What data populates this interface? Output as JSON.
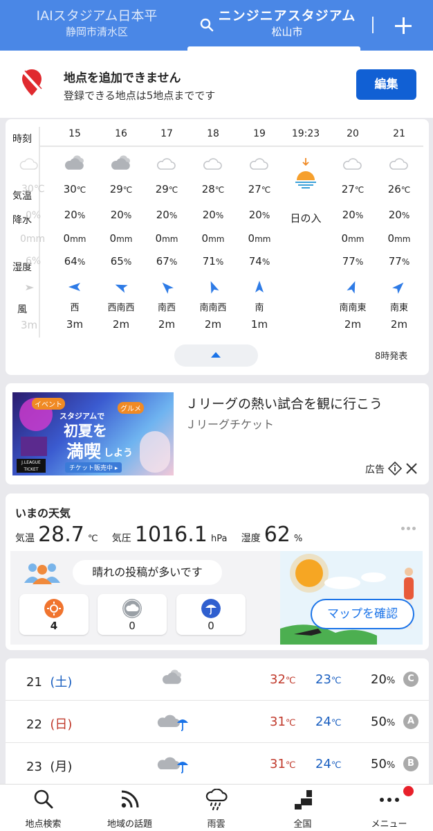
{
  "header": {
    "location_inactive": {
      "name": "IAIスタジアム日本平",
      "area": "静岡市清水区"
    },
    "location_active": {
      "name": "ニンジニアスタジアム",
      "area": "松山市"
    }
  },
  "notice": {
    "title": "地点を追加できません",
    "subtitle": "登録できる地点は5地点までです",
    "edit_label": "編集"
  },
  "hourly": {
    "row_labels": {
      "time": "時刻",
      "temp": "気温",
      "precip": "降水",
      "humidity": "湿度",
      "wind": "風"
    },
    "ghost_column": [
      "30℃",
      "0%",
      "0mm",
      "6%",
      "3m"
    ],
    "columns": [
      {
        "hour": "15",
        "icon": "cloudy-icon",
        "temp": "30",
        "temp_unit": "℃",
        "pop": "20",
        "pop_unit": "%",
        "rain": "0",
        "rain_unit": "mm",
        "hum": "64",
        "hum_unit": "%",
        "wind_dir": "西",
        "wind_speed": "3m",
        "wind_angle": 90
      },
      {
        "hour": "16",
        "icon": "cloudy-icon",
        "temp": "29",
        "temp_unit": "℃",
        "pop": "20",
        "pop_unit": "%",
        "rain": "0",
        "rain_unit": "mm",
        "hum": "65",
        "hum_unit": "%",
        "wind_dir": "西南西",
        "wind_speed": "2m",
        "wind_angle": 68
      },
      {
        "hour": "17",
        "icon": "cloud-outline-icon",
        "temp": "29",
        "temp_unit": "℃",
        "pop": "20",
        "pop_unit": "%",
        "rain": "0",
        "rain_unit": "mm",
        "hum": "67",
        "hum_unit": "%",
        "wind_dir": "南西",
        "wind_speed": "2m",
        "wind_angle": 45
      },
      {
        "hour": "18",
        "icon": "cloud-outline-icon",
        "temp": "28",
        "temp_unit": "℃",
        "pop": "20",
        "pop_unit": "%",
        "rain": "0",
        "rain_unit": "mm",
        "hum": "71",
        "hum_unit": "%",
        "wind_dir": "南南西",
        "wind_speed": "2m",
        "wind_angle": 22
      },
      {
        "hour": "19",
        "icon": "cloud-outline-icon",
        "temp": "27",
        "temp_unit": "℃",
        "pop": "20",
        "pop_unit": "%",
        "rain": "0",
        "rain_unit": "mm",
        "hum": "74",
        "hum_unit": "%",
        "wind_dir": "南",
        "wind_speed": "1m",
        "wind_angle": 0
      },
      {
        "hour": "19:23",
        "icon": "sunset-icon",
        "event": "日の入"
      },
      {
        "hour": "20",
        "icon": "cloud-outline-icon",
        "temp": "27",
        "temp_unit": "℃",
        "pop": "20",
        "pop_unit": "%",
        "rain": "0",
        "rain_unit": "mm",
        "hum": "77",
        "hum_unit": "%",
        "wind_dir": "南南東",
        "wind_speed": "2m",
        "wind_angle": -22
      },
      {
        "hour": "21",
        "icon": "cloud-outline-icon",
        "temp": "26",
        "temp_unit": "℃",
        "pop": "20",
        "pop_unit": "%",
        "rain": "0",
        "rain_unit": "mm",
        "hum": "77",
        "hum_unit": "%",
        "wind_dir": "南東",
        "wind_speed": "2m",
        "wind_angle": -45
      }
    ],
    "published": "8時発表"
  },
  "ad": {
    "title": "Ｊリーグの熱い試合を観に行こう",
    "sponsor": "Ｊリーグチケット",
    "label": "広告",
    "image_text": {
      "l1": "イベント",
      "l2": "グルメ",
      "l3": "スタジアムで",
      "l4": "初夏を",
      "l5": "満喫",
      "l6": "しよう",
      "l7": "チケット販売中 ▸",
      "l8": "J.LEAGUE TICKET"
    }
  },
  "now": {
    "title": "いまの天気",
    "temp_label": "気温",
    "temp_value": "28.7",
    "temp_unit": "℃",
    "pressure_label": "気圧",
    "pressure_value": "1016.1",
    "pressure_unit": "hPa",
    "humidity_label": "湿度",
    "humidity_value": "62",
    "humidity_unit": "%",
    "post_message": "晴れの投稿が多いです",
    "posts": [
      {
        "icon": "sunny-post-icon",
        "count": "4"
      },
      {
        "icon": "cloudy-post-icon",
        "count": "0"
      },
      {
        "icon": "rainy-post-icon",
        "count": "0"
      }
    ],
    "map_button": "マップを確認"
  },
  "forecast": [
    {
      "day": "21",
      "weekday": "(土)",
      "weekday_color": "#1a5fc0",
      "icon": "cloudy-icon",
      "high": "32",
      "low": "23",
      "unit": "℃",
      "pop": "20",
      "pop_unit": "%",
      "grade": "C"
    },
    {
      "day": "22",
      "weekday": "(日)",
      "weekday_color": "#c0392b",
      "icon": "cloud-rain-icon",
      "high": "31",
      "low": "24",
      "unit": "℃",
      "pop": "50",
      "pop_unit": "%",
      "grade": "A"
    },
    {
      "day": "23",
      "weekday": "(月)",
      "weekday_color": "#222222",
      "icon": "cloud-rain-icon",
      "high": "31",
      "low": "24",
      "unit": "℃",
      "pop": "50",
      "pop_unit": "%",
      "grade": "B"
    }
  ],
  "nav": [
    {
      "label": "地点検索",
      "icon": "search-icon"
    },
    {
      "label": "地域の話題",
      "icon": "rss-icon"
    },
    {
      "label": "雨雲",
      "icon": "rain-cloud-icon"
    },
    {
      "label": "全国",
      "icon": "japan-map-icon"
    },
    {
      "label": "メニュー",
      "icon": "more-dots-icon"
    }
  ],
  "colors": {
    "header": "#4a87e6",
    "accent": "#1160d4",
    "wind_arrow": "#2e7be6",
    "high": "#c0392b",
    "low": "#1a5fc0"
  }
}
